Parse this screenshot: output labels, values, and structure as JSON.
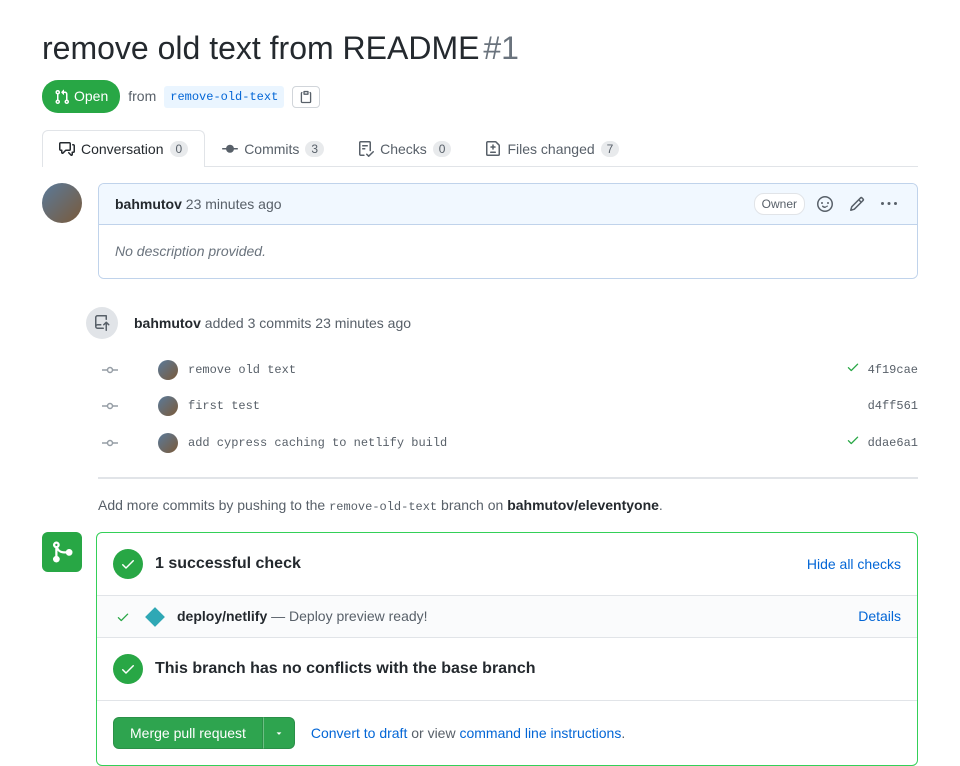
{
  "header": {
    "title": "remove old text from README",
    "number": "#1",
    "state": "Open",
    "from_label": "from",
    "branch": "remove-old-text"
  },
  "tabs": {
    "conversation": {
      "label": "Conversation",
      "count": "0"
    },
    "commits": {
      "label": "Commits",
      "count": "3"
    },
    "checks": {
      "label": "Checks",
      "count": "0"
    },
    "files": {
      "label": "Files changed",
      "count": "7"
    }
  },
  "comment": {
    "author": "bahmutov",
    "time": "23 minutes ago",
    "badge": "Owner",
    "body": "No description provided."
  },
  "push_event": {
    "author": "bahmutov",
    "action": "added 3 commits",
    "time": "23 minutes ago"
  },
  "commits": [
    {
      "message": "remove old text",
      "sha": "4f19cae",
      "status": "success"
    },
    {
      "message": "first test",
      "sha": "d4ff561",
      "status": "none"
    },
    {
      "message": "add cypress caching to netlify build",
      "sha": "ddae6a1",
      "status": "success"
    }
  ],
  "hint": {
    "prefix": "Add more commits by pushing to the ",
    "branch": "remove-old-text",
    "mid": " branch on ",
    "repo": "bahmutov/eleventyone",
    "suffix": "."
  },
  "merge": {
    "checks_title": "1 successful check",
    "hide_link": "Hide all checks",
    "check_name": "deploy/netlify",
    "check_desc": "— Deploy preview ready!",
    "details_link": "Details",
    "conflict_title": "This branch has no conflicts with the base branch",
    "button": "Merge pull request",
    "convert": "Convert to draft",
    "or_view": " or view ",
    "cli": "command line instructions",
    "period": "."
  }
}
